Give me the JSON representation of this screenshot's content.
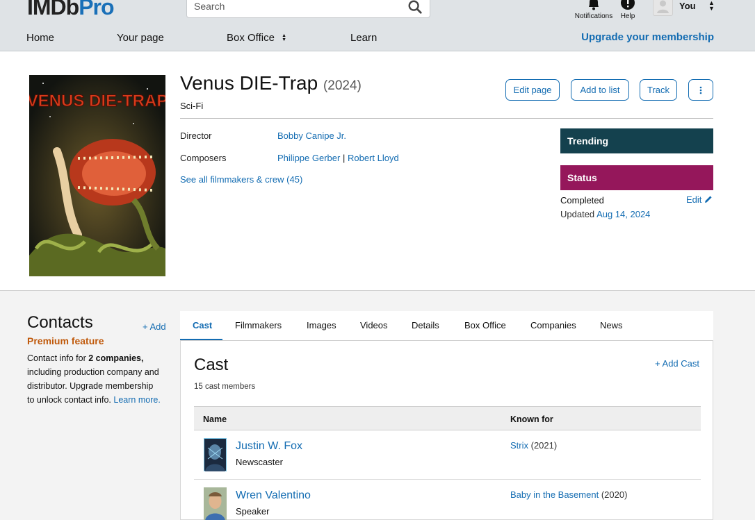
{
  "header": {
    "logo_main": "IMDb",
    "logo_suffix": "Pro",
    "search_placeholder": "Search",
    "notifications_label": "Notifications",
    "help_label": "Help",
    "user_label": "You",
    "nav": [
      "Home",
      "Your page",
      "Box Office",
      "Learn"
    ],
    "upgrade_label": "Upgrade your membership"
  },
  "title": {
    "name": "Venus DIE-Trap",
    "year": "(2024)",
    "genre": "Sci-Fi",
    "poster_title": "VENUS DIE-TRAP",
    "actions": [
      "Edit page",
      "Add to list",
      "Track"
    ]
  },
  "crew": {
    "director_label": "Director",
    "director": "Bobby Canipe Jr.",
    "composers_label": "Composers",
    "composer_1": "Philippe Gerber",
    "separator": "|",
    "composer_2": "Robert Lloyd",
    "see_all": "See all filmmakers & crew (45)"
  },
  "sidebar_panels": {
    "trending_label": "Trending",
    "status_label": "Status",
    "status_value": "Completed",
    "edit_label": "Edit",
    "updated_prefix": "Updated",
    "updated_date": "Aug 14, 2024",
    "trending_color": "#14414e",
    "status_color": "#95175b"
  },
  "contacts": {
    "heading": "Contacts",
    "add_label": "+ Add",
    "premium_label": "Premium feature",
    "body_prefix": "Contact info for ",
    "body_bold": "2 companies,",
    "body_rest": " including production company and distributor. Upgrade membership to unlock contact info. ",
    "learn_more": "Learn more."
  },
  "tabs": [
    "Cast",
    "Filmmakers",
    "Images",
    "Videos",
    "Details",
    "Box Office",
    "Companies",
    "News"
  ],
  "cast": {
    "heading": "Cast",
    "add_label": "+ Add Cast",
    "count": "15 cast members",
    "col_name": "Name",
    "col_known": "Known for",
    "rows": [
      {
        "name": "Justin W. Fox",
        "role": "Newscaster",
        "known_title": "Strix",
        "known_year": "(2021)"
      },
      {
        "name": "Wren Valentino",
        "role": "Speaker",
        "known_title": "Baby in the Basement",
        "known_year": "(2020)"
      }
    ]
  }
}
